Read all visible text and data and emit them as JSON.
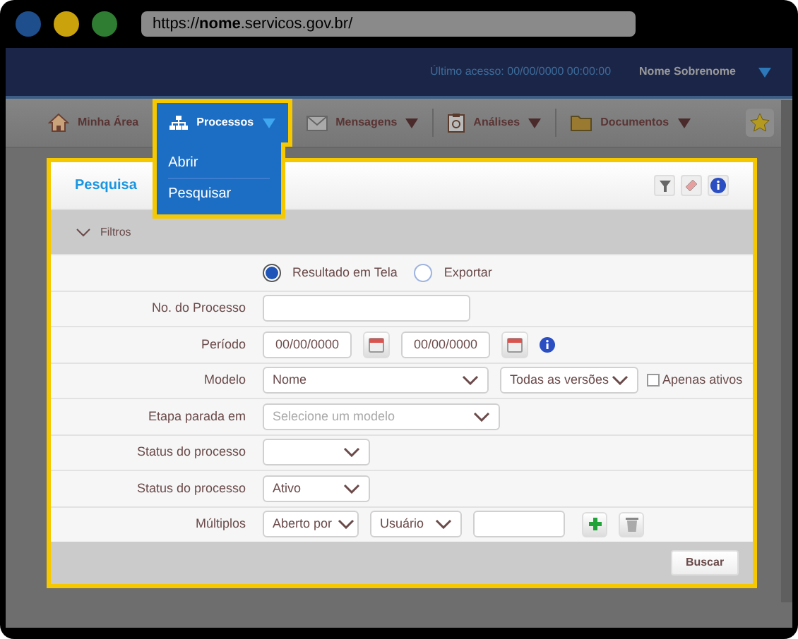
{
  "browser": {
    "dots": [
      {
        "color": "#1f4e8c"
      },
      {
        "color": "#c9a20c"
      },
      {
        "color": "#2e7d32"
      }
    ],
    "url": "https://**nome**.servicos.gov.br/"
  },
  "header": {
    "last_access": "Último acesso: 00/00/0000 00:00:00",
    "user": "Nome Sobrenome"
  },
  "nav": {
    "items": [
      {
        "label": "Minha Área",
        "kind": "home",
        "selected": false,
        "caret": false
      },
      {
        "label": "Processos",
        "kind": "flow",
        "selected": true,
        "caret": true
      },
      {
        "label": "Mensagens",
        "kind": "mail",
        "selected": false,
        "caret": true
      },
      {
        "label": "Análises",
        "kind": "report",
        "selected": false,
        "caret": true
      },
      {
        "label": "Documentos",
        "kind": "folder",
        "selected": false,
        "caret": true
      }
    ],
    "menu": [
      "Abrir",
      "Pesquisar"
    ]
  },
  "panel": {
    "title": "Pesquisa",
    "section": {
      "label": "Filtros",
      "expanded": true
    },
    "rows": [
      {
        "kind": "radios",
        "options": [
          {
            "label": "Resultado em Tela",
            "selected": true
          },
          {
            "label": "Exportar",
            "selected": false
          }
        ]
      },
      {
        "kind": "text",
        "label": "No. do Processo"
      },
      {
        "kind": "dates",
        "label": "Período",
        "dates": [
          "00/00/0000",
          "00/00/0000"
        ]
      },
      {
        "kind": "model",
        "label": "Modelo",
        "value": "Nome",
        "version": "Todas as versões",
        "checkbox": {
          "label": "Apenas ativos",
          "checked": false
        }
      },
      {
        "kind": "select_wide",
        "label": "Etapa parada em",
        "placeholder": "Selecione um modelo"
      },
      {
        "kind": "select",
        "label": "Status do processo"
      },
      {
        "kind": "select",
        "label": "Status do processo",
        "value": "Ativo"
      },
      {
        "kind": "multi",
        "label": "Múltiplos",
        "selects": [
          "Aberto por",
          "Usuário"
        ]
      }
    ],
    "button": "Buscar"
  }
}
